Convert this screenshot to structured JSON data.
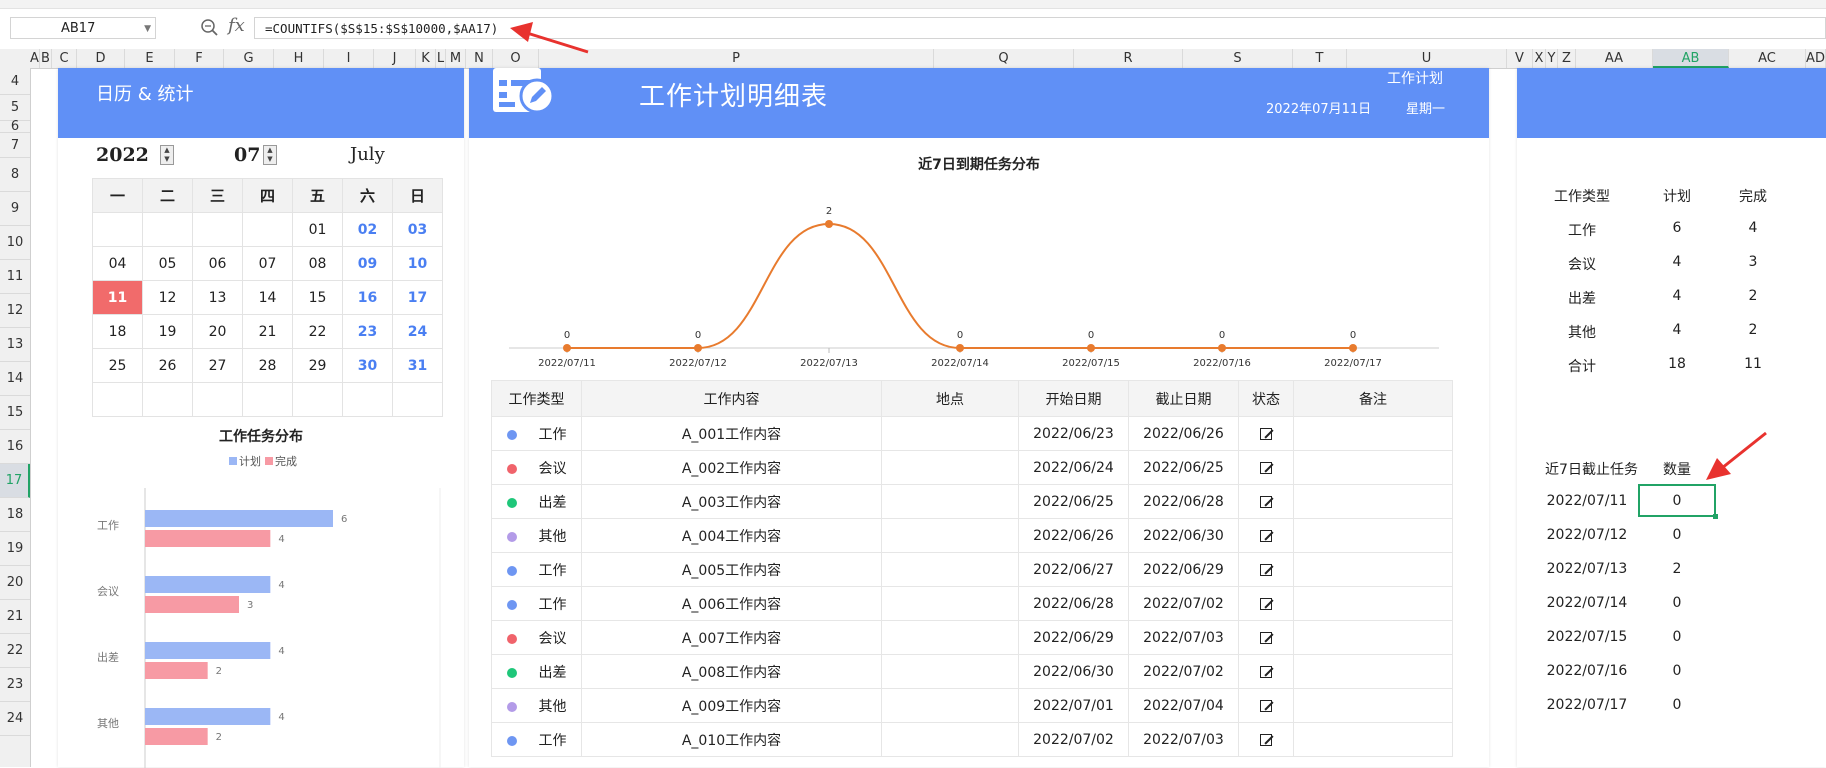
{
  "formula_bar": {
    "cell_ref": "AB17",
    "fx_label": "fx",
    "formula": "=COUNTIFS($S$15:$S$10000,$AA17)"
  },
  "columns": [
    "A",
    "B",
    "C",
    "D",
    "E",
    "F",
    "G",
    "H",
    "I",
    "J",
    "K",
    "L",
    "M",
    "N",
    "O",
    "P",
    "Q",
    "R",
    "S",
    "T",
    "U",
    "V",
    "X",
    "Y",
    "Z",
    "AA",
    "AB",
    "AC",
    "AD"
  ],
  "selected_column": "AB",
  "rows": [
    "4",
    "5",
    "6",
    "7",
    "8",
    "9",
    "10",
    "11",
    "12",
    "13",
    "14",
    "15",
    "16",
    "17",
    "18",
    "19",
    "20",
    "21",
    "22",
    "23",
    "24"
  ],
  "selected_row": "17",
  "left_panel": {
    "title": "日历 & 统计",
    "year": "2022",
    "month": "07",
    "month_name": "July",
    "weekdays": [
      "一",
      "二",
      "三",
      "四",
      "五",
      "六",
      "日"
    ],
    "weeks": [
      [
        "",
        "",
        "",
        "",
        "01",
        "02",
        "03"
      ],
      [
        "04",
        "05",
        "06",
        "07",
        "08",
        "09",
        "10"
      ],
      [
        "11",
        "12",
        "13",
        "14",
        "15",
        "16",
        "17"
      ],
      [
        "18",
        "19",
        "20",
        "21",
        "22",
        "23",
        "24"
      ],
      [
        "25",
        "26",
        "27",
        "28",
        "29",
        "30",
        "31"
      ],
      [
        "",
        "",
        "",
        "",
        "",
        "",
        ""
      ]
    ],
    "today": "11",
    "bar_chart": {
      "type": "bar",
      "title": "工作任务分布",
      "legend": [
        "计划",
        "完成"
      ],
      "categories": [
        "工作",
        "会议",
        "出差",
        "其他"
      ],
      "series": [
        {
          "name": "计划",
          "values": [
            6,
            4,
            4,
            4
          ],
          "color": "#9bb7f5"
        },
        {
          "name": "完成",
          "values": [
            4,
            3,
            2,
            2
          ],
          "color": "#f79aa4"
        }
      ]
    }
  },
  "mid_panel": {
    "title": "工作计划明细表",
    "subtitle": "工作计划",
    "date": "2022年07月11日",
    "weekday": "星期一",
    "line_chart": {
      "type": "line",
      "title": "近7日到期任务分布",
      "x": [
        "2022/07/11",
        "2022/07/12",
        "2022/07/13",
        "2022/07/14",
        "2022/07/15",
        "2022/07/16",
        "2022/07/17"
      ],
      "values": [
        0,
        0,
        2,
        0,
        0,
        0,
        0
      ],
      "color": "#e87b2e"
    },
    "table": {
      "headers": [
        "工作类型",
        "工作内容",
        "地点",
        "开始日期",
        "截止日期",
        "状态",
        "备注"
      ],
      "rows": [
        {
          "color": "#6e96f2",
          "type": "工作",
          "content": "A_001工作内容",
          "place": "",
          "start": "2022/06/23",
          "end": "2022/06/26"
        },
        {
          "color": "#f0636b",
          "type": "会议",
          "content": "A_002工作内容",
          "place": "",
          "start": "2022/06/24",
          "end": "2022/06/25"
        },
        {
          "color": "#1fc77a",
          "type": "出差",
          "content": "A_003工作内容",
          "place": "",
          "start": "2022/06/25",
          "end": "2022/06/28"
        },
        {
          "color": "#b39be8",
          "type": "其他",
          "content": "A_004工作内容",
          "place": "",
          "start": "2022/06/26",
          "end": "2022/06/30"
        },
        {
          "color": "#6e96f2",
          "type": "工作",
          "content": "A_005工作内容",
          "place": "",
          "start": "2022/06/27",
          "end": "2022/06/29"
        },
        {
          "color": "#6e96f2",
          "type": "工作",
          "content": "A_006工作内容",
          "place": "",
          "start": "2022/06/28",
          "end": "2022/07/02"
        },
        {
          "color": "#f0636b",
          "type": "会议",
          "content": "A_007工作内容",
          "place": "",
          "start": "2022/06/29",
          "end": "2022/07/03"
        },
        {
          "color": "#1fc77a",
          "type": "出差",
          "content": "A_008工作内容",
          "place": "",
          "start": "2022/06/30",
          "end": "2022/07/02"
        },
        {
          "color": "#b39be8",
          "type": "其他",
          "content": "A_009工作内容",
          "place": "",
          "start": "2022/07/01",
          "end": "2022/07/04"
        },
        {
          "color": "#6e96f2",
          "type": "工作",
          "content": "A_010工作内容",
          "place": "",
          "start": "2022/07/02",
          "end": "2022/07/03"
        }
      ]
    }
  },
  "right_panel": {
    "summary_headers": [
      "工作类型",
      "计划",
      "完成"
    ],
    "summary_rows": [
      [
        "工作",
        "6",
        "4"
      ],
      [
        "会议",
        "4",
        "3"
      ],
      [
        "出差",
        "4",
        "2"
      ],
      [
        "其他",
        "4",
        "2"
      ],
      [
        "合计",
        "18",
        "11"
      ]
    ],
    "deadline_headers": [
      "近7日截止任务",
      "数量"
    ],
    "deadline_rows": [
      [
        "2022/07/11",
        "0"
      ],
      [
        "2022/07/12",
        "0"
      ],
      [
        "2022/07/13",
        "2"
      ],
      [
        "2022/07/14",
        "0"
      ],
      [
        "2022/07/15",
        "0"
      ],
      [
        "2022/07/16",
        "0"
      ],
      [
        "2022/07/17",
        "0"
      ]
    ]
  },
  "colors": {
    "banner": "#6090f6",
    "annotation_arrow": "#e8322e",
    "selection": "#21a366"
  }
}
